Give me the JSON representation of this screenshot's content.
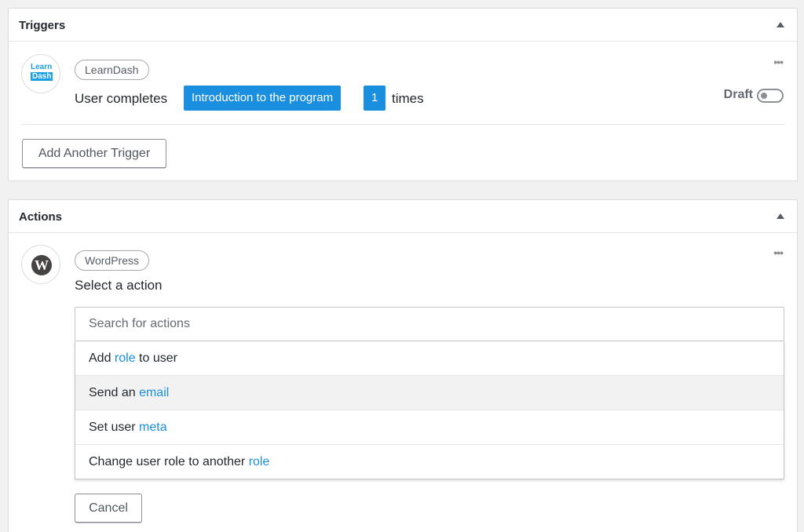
{
  "triggers": {
    "title": "Triggers",
    "integration": "LearnDash",
    "logo": {
      "line1": "Learn",
      "line2": "Dash"
    },
    "sentence": {
      "prefix": "User completes",
      "token_course": "Introduction to the program",
      "token_count": "1",
      "suffix": "times"
    },
    "status_label": "Draft",
    "status_enabled": false,
    "more": "•••",
    "add_button": "Add Another Trigger"
  },
  "actions": {
    "title": "Actions",
    "integration": "WordPress",
    "logo": "W",
    "prompt": "Select a action",
    "more": "•••",
    "search_placeholder": "Search for actions",
    "results": [
      {
        "pre": "Add ",
        "kw": "role",
        "post": " to user"
      },
      {
        "pre": "Send an ",
        "kw": "email",
        "post": ""
      },
      {
        "pre": "Set user ",
        "kw": "meta",
        "post": ""
      },
      {
        "pre": "Change user role to another ",
        "kw": "role",
        "post": ""
      }
    ],
    "highlighted_index": 1,
    "cancel_button": "Cancel"
  },
  "colors": {
    "accent": "#1a8fe0",
    "background": "#f1f1f1",
    "panel": "#ffffff"
  },
  "icons": [
    "collapse-arrow-icon",
    "more-options-icon",
    "learndash-logo-icon",
    "wordpress-logo-icon",
    "toggle-switch-icon"
  ]
}
